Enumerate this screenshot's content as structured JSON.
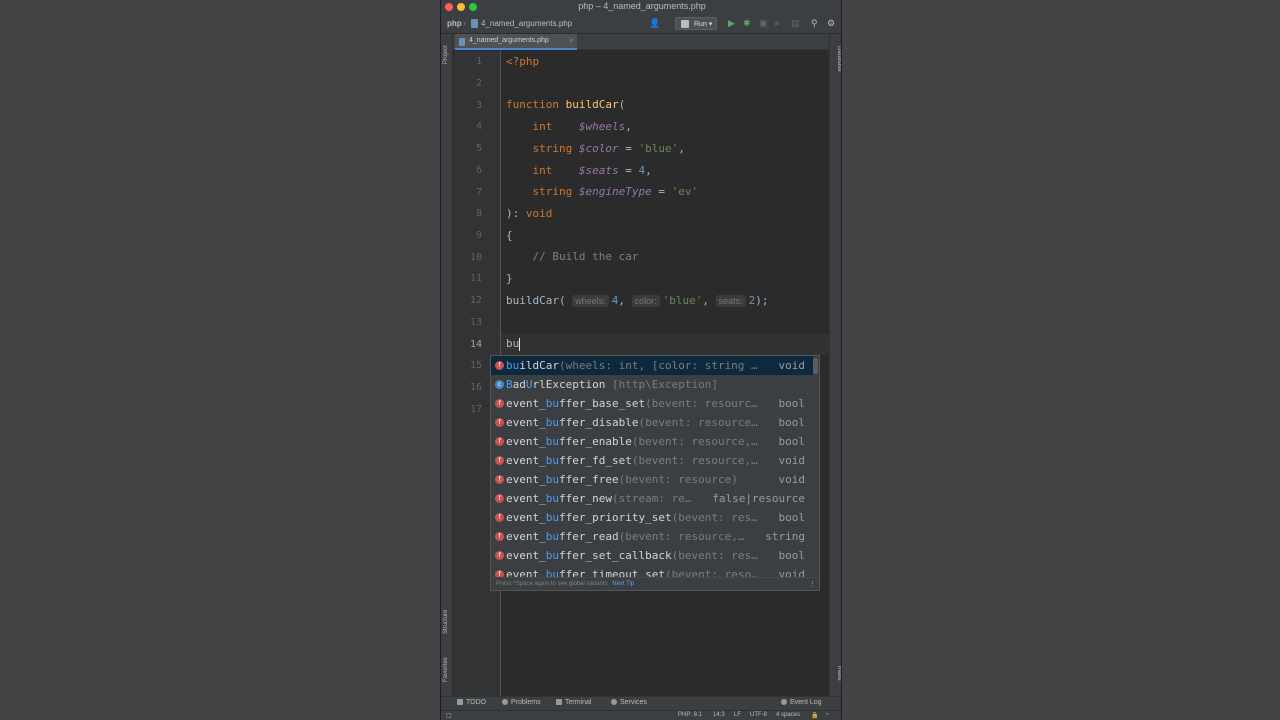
{
  "window": {
    "title": "php – 4_named_arguments.php"
  },
  "navbar": {
    "project": "php",
    "file": "4_named_arguments.php",
    "run_label": "Run"
  },
  "tab": {
    "label": "4_named_arguments.php"
  },
  "side_tools": {
    "project": "Project",
    "structure": "Structure",
    "favorites": "Favorites",
    "database": "Database",
    "make": "make"
  },
  "editor": {
    "line_numbers": [
      "1",
      "2",
      "3",
      "4",
      "5",
      "6",
      "7",
      "8",
      "9",
      "10",
      "11",
      "12",
      "13",
      "14",
      "15",
      "16",
      "17"
    ],
    "current_line": "14",
    "code": {
      "l1": "<?php",
      "l3_kw": "function",
      "l3_fn": "buildCar",
      "l3_paren": "(",
      "l4_type": "int",
      "l4_var": "$wheels",
      "l4_punct": ",",
      "l5_type": "string",
      "l5_var": "$color",
      "l5_eq": " = ",
      "l5_str": "'blue'",
      "l5_punct": ",",
      "l6_type": "int",
      "l6_var": "$seats",
      "l6_eq": " = ",
      "l6_num": "4",
      "l6_punct": ",",
      "l7_type": "string",
      "l7_var": "$engineType",
      "l7_eq": " = ",
      "l7_str": "'ev'",
      "l8_punct": "): ",
      "l8_kw": "void",
      "l9": "{",
      "l10": "// Build the car",
      "l11": "}",
      "l12_fn": "buildCar(",
      "l12_h1": "wheels:",
      "l12_v1": "4",
      "l12_c1": ", ",
      "l12_h2": "color:",
      "l12_v2": "'blue'",
      "l12_c2": ", ",
      "l12_h3": "seats:",
      "l12_v3": "2",
      "l12_end": ");",
      "l14": "bu"
    }
  },
  "completion": {
    "items": [
      {
        "hl": "bu",
        "rest": "ildCar",
        "sig": "(wheels: int, [color: string …",
        "type": "void"
      },
      {
        "hl1": "B",
        "mid1": "ad",
        "hl2": "U",
        "rest": "rlException",
        "sig": " [http\\Exception]",
        "type": ""
      },
      {
        "pre": "event_",
        "hl": "bu",
        "rest": "ffer_base_set",
        "sig": "(bevent: resourc…",
        "type": "bool"
      },
      {
        "pre": "event_",
        "hl": "bu",
        "rest": "ffer_disable",
        "sig": "(bevent: resource…",
        "type": "bool"
      },
      {
        "pre": "event_",
        "hl": "bu",
        "rest": "ffer_enable",
        "sig": "(bevent: resource,…",
        "type": "bool"
      },
      {
        "pre": "event_",
        "hl": "bu",
        "rest": "ffer_fd_set",
        "sig": "(bevent: resource,…",
        "type": "void"
      },
      {
        "pre": "event_",
        "hl": "bu",
        "rest": "ffer_free",
        "sig": "(bevent: resource)",
        "type": "void"
      },
      {
        "pre": "event_",
        "hl": "bu",
        "rest": "ffer_new",
        "sig": "(stream: re…",
        "type": "false|resource"
      },
      {
        "pre": "event_",
        "hl": "bu",
        "rest": "ffer_priority_set",
        "sig": "(bevent: res…",
        "type": "bool"
      },
      {
        "pre": "event_",
        "hl": "bu",
        "rest": "ffer_read",
        "sig": "(bevent: resource,…",
        "type": "string"
      },
      {
        "pre": "event_",
        "hl": "bu",
        "rest": "ffer_set_callback",
        "sig": "(bevent: res…",
        "type": "bool"
      },
      {
        "pre": "event_",
        "hl": "bu",
        "rest": "ffer_timeout_set",
        "sig": "(bevent: reso…",
        "type": "void"
      }
    ],
    "footer": "Press ^Space again to see global variants",
    "next_tip": "Next Tip"
  },
  "bottom_tools": {
    "todo": "TODO",
    "problems": "Problems",
    "terminal": "Terminal",
    "services": "Services",
    "event_log": "Event Log"
  },
  "status": {
    "php": "PHP: 8.1",
    "position": "14:3",
    "line_sep": "LF",
    "encoding": "UTF-8",
    "indent": "4 spaces"
  },
  "colors": {
    "background": "#2b2b2b",
    "keyword": "#cc7832",
    "function": "#ffc66d",
    "variable": "#9876aa",
    "string": "#6a8759",
    "number": "#6897bb",
    "match": "#4a9cf0"
  }
}
